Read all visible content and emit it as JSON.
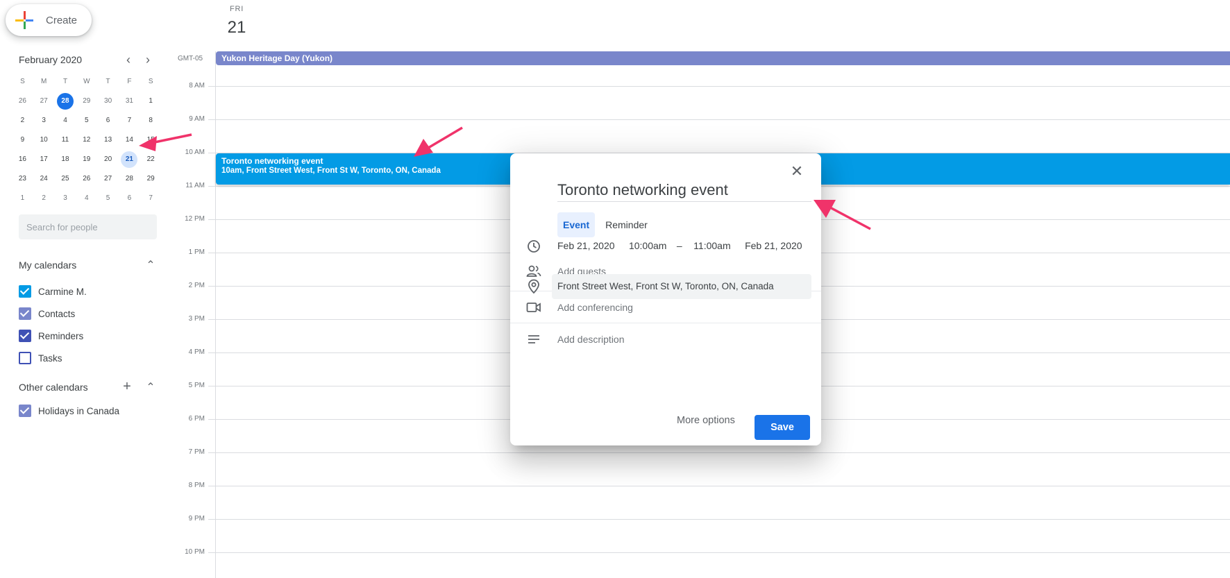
{
  "create": {
    "label": "Create"
  },
  "mini_calendar": {
    "month_title": "February 2020",
    "prev_icon": "chevron-left-icon",
    "next_icon": "chevron-right-icon",
    "weekdays": [
      "S",
      "M",
      "T",
      "W",
      "T",
      "F",
      "S"
    ],
    "weeks": [
      [
        "26",
        "27",
        "28",
        "29",
        "30",
        "31",
        "1"
      ],
      [
        "2",
        "3",
        "4",
        "5",
        "6",
        "7",
        "8"
      ],
      [
        "9",
        "10",
        "11",
        "12",
        "13",
        "14",
        "15"
      ],
      [
        "16",
        "17",
        "18",
        "19",
        "20",
        "21",
        "22"
      ],
      [
        "23",
        "24",
        "25",
        "26",
        "27",
        "28",
        "29"
      ],
      [
        "1",
        "2",
        "3",
        "4",
        "5",
        "6",
        "7"
      ]
    ],
    "today": "28",
    "selected": "21"
  },
  "search_people": {
    "placeholder": "Search for people"
  },
  "my_calendars": {
    "title": "My calendars",
    "items": [
      {
        "label": "Carmine M.",
        "checked": true,
        "color": "#039be5"
      },
      {
        "label": "Contacts",
        "checked": true,
        "color": "#7986cb"
      },
      {
        "label": "Reminders",
        "checked": true,
        "color": "#3f51b5"
      },
      {
        "label": "Tasks",
        "checked": false,
        "color": "#3f51b5"
      }
    ]
  },
  "other_calendars": {
    "title": "Other calendars",
    "items": [
      {
        "label": "Holidays in Canada",
        "checked": true,
        "color": "#7986cb"
      }
    ]
  },
  "day_view": {
    "day_of_week": "FRI",
    "day_number": "21",
    "timezone": "GMT-05",
    "all_day_event": "Yukon Heritage Day (Yukon)",
    "hours": [
      "8 AM",
      "9 AM",
      "10 AM",
      "11 AM",
      "12 PM",
      "1 PM",
      "2 PM",
      "3 PM",
      "4 PM",
      "5 PM",
      "6 PM",
      "7 PM",
      "8 PM",
      "9 PM",
      "10 PM"
    ],
    "event": {
      "title": "Toronto networking event",
      "subtitle": "10am, Front Street West, Front St W, Toronto, ON, Canada"
    }
  },
  "dialog": {
    "title_value": "Toronto networking event",
    "tabs": {
      "event": "Event",
      "reminder": "Reminder"
    },
    "start_date": "Feb 21, 2020",
    "start_time": "10:00am",
    "dash": "–",
    "end_time": "11:00am",
    "end_date": "Feb 21, 2020",
    "add_guests": "Add guests",
    "location": "Front Street West, Front St W, Toronto, ON, Canada",
    "add_conferencing": "Add conferencing",
    "add_description": "Add description",
    "more_options": "More options",
    "save": "Save"
  },
  "colors": {
    "accent": "#1a73e8",
    "event": "#039be5",
    "holiday": "#7986cb",
    "arrow": "#f0336a"
  }
}
